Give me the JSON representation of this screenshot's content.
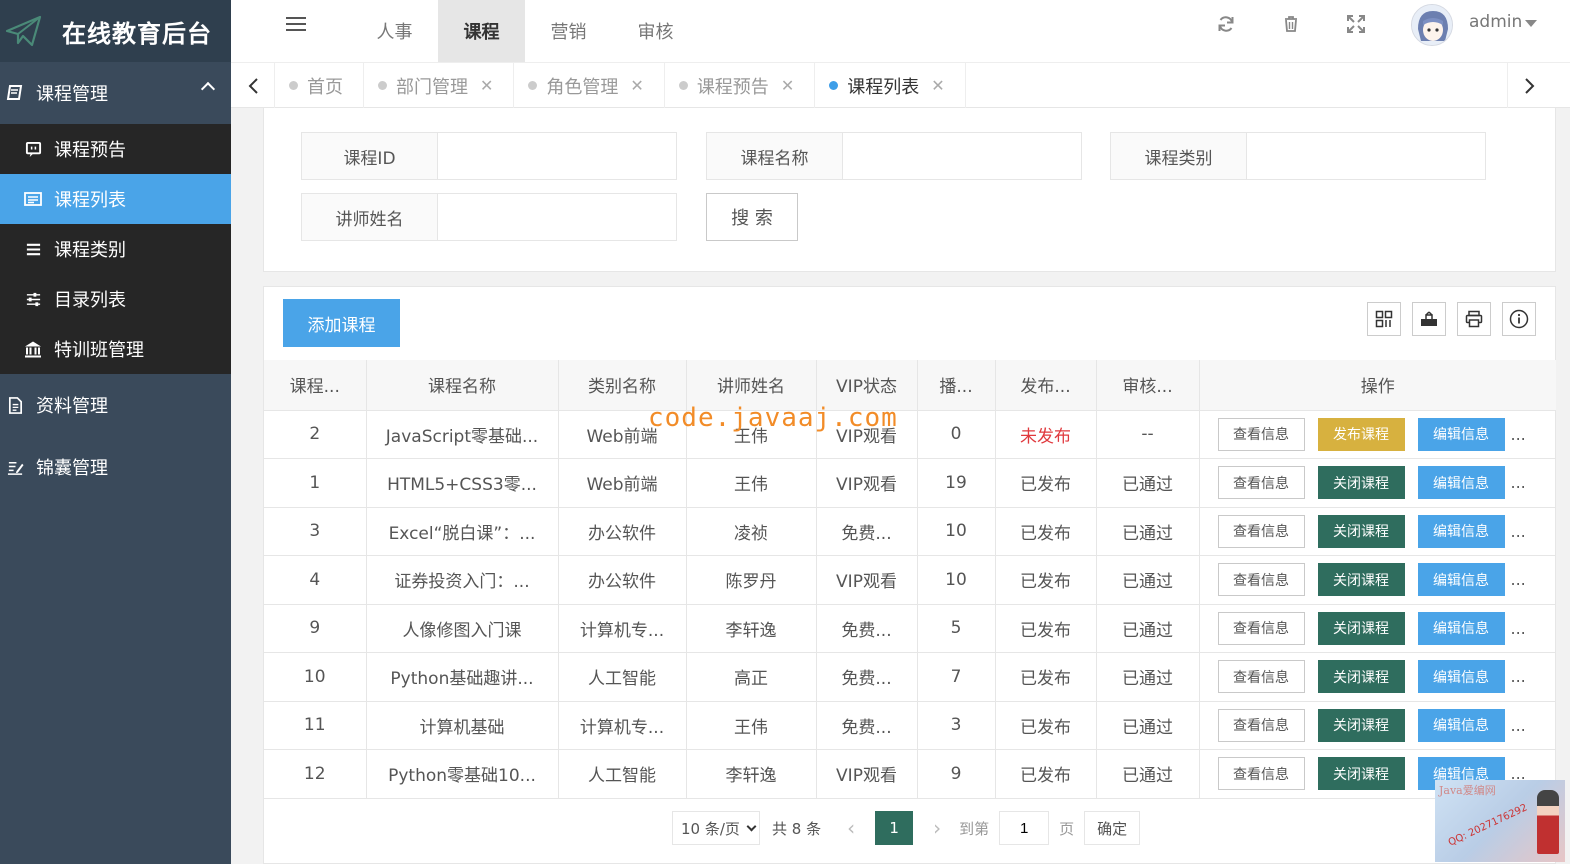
{
  "app": {
    "title": "在线教育后台"
  },
  "sidebar": {
    "groups": [
      {
        "label": "课程管理",
        "icon": "book-icon",
        "open": true,
        "items": [
          {
            "label": "课程预告",
            "icon": "preview-icon",
            "active": false
          },
          {
            "label": "课程列表",
            "icon": "list-icon",
            "active": true
          },
          {
            "label": "课程类别",
            "icon": "menu-lines-icon",
            "active": false
          },
          {
            "label": "目录列表",
            "icon": "sliders-icon",
            "active": false
          },
          {
            "label": "特训班管理",
            "icon": "bank-icon",
            "active": false
          }
        ]
      },
      {
        "label": "资料管理",
        "icon": "document-icon",
        "open": false
      },
      {
        "label": "锦囊管理",
        "icon": "edit-doc-icon",
        "open": false
      }
    ]
  },
  "header": {
    "nav": [
      {
        "label": "人事",
        "active": false
      },
      {
        "label": "课程",
        "active": true
      },
      {
        "label": "营销",
        "active": false
      },
      {
        "label": "审核",
        "active": false
      }
    ],
    "user": "admin"
  },
  "tabs": [
    {
      "label": "首页",
      "closable": false,
      "active": false
    },
    {
      "label": "部门管理",
      "closable": true,
      "active": false
    },
    {
      "label": "角色管理",
      "closable": true,
      "active": false
    },
    {
      "label": "课程预告",
      "closable": true,
      "active": false
    },
    {
      "label": "课程列表",
      "closable": true,
      "active": true
    }
  ],
  "search": {
    "course_id_label": "课程ID",
    "course_name_label": "课程名称",
    "category_label": "课程类别",
    "teacher_label": "讲师姓名",
    "button": "搜 索"
  },
  "toolbar": {
    "add_label": "添加课程"
  },
  "table": {
    "columns": [
      "课程...",
      "课程名称",
      "类别名称",
      "讲师姓名",
      "VIP状态",
      "播...",
      "发布...",
      "审核...",
      "操作"
    ],
    "rows": [
      {
        "id": "2",
        "name": "JavaScript零基础...",
        "category": "Web前端",
        "teacher": "王伟",
        "vip": "VIP观看",
        "plays": "0",
        "publish": "未发布",
        "audit": "--",
        "action": "发布课程"
      },
      {
        "id": "1",
        "name": "HTML5+CSS3零...",
        "category": "Web前端",
        "teacher": "王伟",
        "vip": "VIP观看",
        "plays": "19",
        "publish": "已发布",
        "audit": "已通过",
        "action": "关闭课程"
      },
      {
        "id": "3",
        "name": "Excel“脱白课”：...",
        "category": "办公软件",
        "teacher": "凌祯",
        "vip": "免费...",
        "plays": "10",
        "publish": "已发布",
        "audit": "已通过",
        "action": "关闭课程"
      },
      {
        "id": "4",
        "name": "证券投资入门：...",
        "category": "办公软件",
        "teacher": "陈罗丹",
        "vip": "VIP观看",
        "plays": "10",
        "publish": "已发布",
        "audit": "已通过",
        "action": "关闭课程"
      },
      {
        "id": "9",
        "name": "人像修图入门课",
        "category": "计算机专...",
        "teacher": "李轩逸",
        "vip": "免费...",
        "plays": "5",
        "publish": "已发布",
        "audit": "已通过",
        "action": "关闭课程"
      },
      {
        "id": "10",
        "name": "Python基础趣讲...",
        "category": "人工智能",
        "teacher": "高正",
        "vip": "免费...",
        "plays": "7",
        "publish": "已发布",
        "audit": "已通过",
        "action": "关闭课程"
      },
      {
        "id": "11",
        "name": "计算机基础",
        "category": "计算机专...",
        "teacher": "王伟",
        "vip": "免费...",
        "plays": "3",
        "publish": "已发布",
        "audit": "已通过",
        "action": "关闭课程"
      },
      {
        "id": "12",
        "name": "Python零基础10...",
        "category": "人工智能",
        "teacher": "李轩逸",
        "vip": "VIP观看",
        "plays": "9",
        "publish": "已发布",
        "audit": "已通过",
        "action": "关闭课程"
      }
    ],
    "view_label": "查看信息",
    "edit_label": "编辑信息",
    "more": "..."
  },
  "pagination": {
    "page_size": "10 条/页",
    "total": "共 8 条",
    "current": "1",
    "goto_label": "到第",
    "goto_value": "1",
    "page_unit": "页",
    "confirm": "确定"
  },
  "watermark": {
    "text": "code.javaaj.com",
    "thumb_title": "Java爱编网",
    "thumb_qq": "QQ: 2027176292"
  },
  "colors": {
    "sidebar": "#3a4a5b",
    "submenu": "#262626",
    "active": "#4aa4e8",
    "close_btn": "#2f6d5e",
    "publish_btn": "#d7b13f",
    "unpublished": "#e0393e"
  }
}
